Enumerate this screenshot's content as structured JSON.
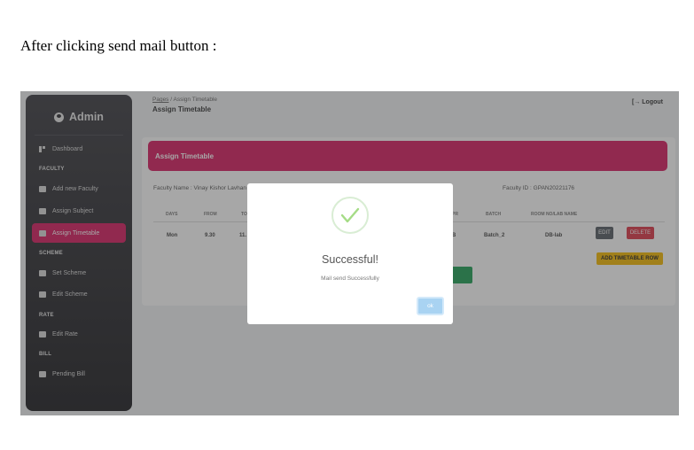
{
  "doc": {
    "caption": "After clicking send mail button :"
  },
  "sidebar": {
    "brand": "Admin",
    "dashboard": "Dashboard",
    "sections": {
      "faculty": "FACULTY",
      "scheme": "SCHEME",
      "rate": "RATE",
      "bill": "BILL"
    },
    "items": {
      "add_faculty": "Add new Faculty",
      "assign_subject": "Assign Subject",
      "assign_timetable": "Assign Timetable",
      "set_scheme": "Set Scheme",
      "edit_scheme": "Edit Scheme",
      "edit_rate": "Edit Rate",
      "pending_bill": "Pending Bill"
    },
    "active_item": "Assign Timetable",
    "active_color": "#d81b60"
  },
  "header": {
    "breadcrumb_root": "Pages",
    "breadcrumb_sep": "/",
    "breadcrumb_current": "Assign Timetable",
    "title": "Assign Timetable",
    "logout": "[→ Logout"
  },
  "card": {
    "title": "Assign Timetable",
    "faculty_name": "Faculty Name : Vinay Kishor Lavhan",
    "faculty_id": "Faculty ID : GPAN20221176",
    "columns": {
      "days": "DAYS",
      "from": "FROM",
      "to": "TO",
      "type": "PR",
      "batch": "BATCH",
      "room": "ROOM NO/LAB NAME"
    },
    "row": {
      "days": "Mon",
      "from": "9.30",
      "to": "11.",
      "type": "B",
      "batch": "Batch_2",
      "room": "DB-lab"
    },
    "edit_label": "EDIT",
    "delete_label": "DELETE",
    "add_row_label": "ADD TIMETABLE ROW"
  },
  "modal": {
    "title": "Successful!",
    "message": "Mail send Successfully",
    "ok_label": "ok",
    "icon": "success-check-icon",
    "check_color": "#a5dc86"
  }
}
